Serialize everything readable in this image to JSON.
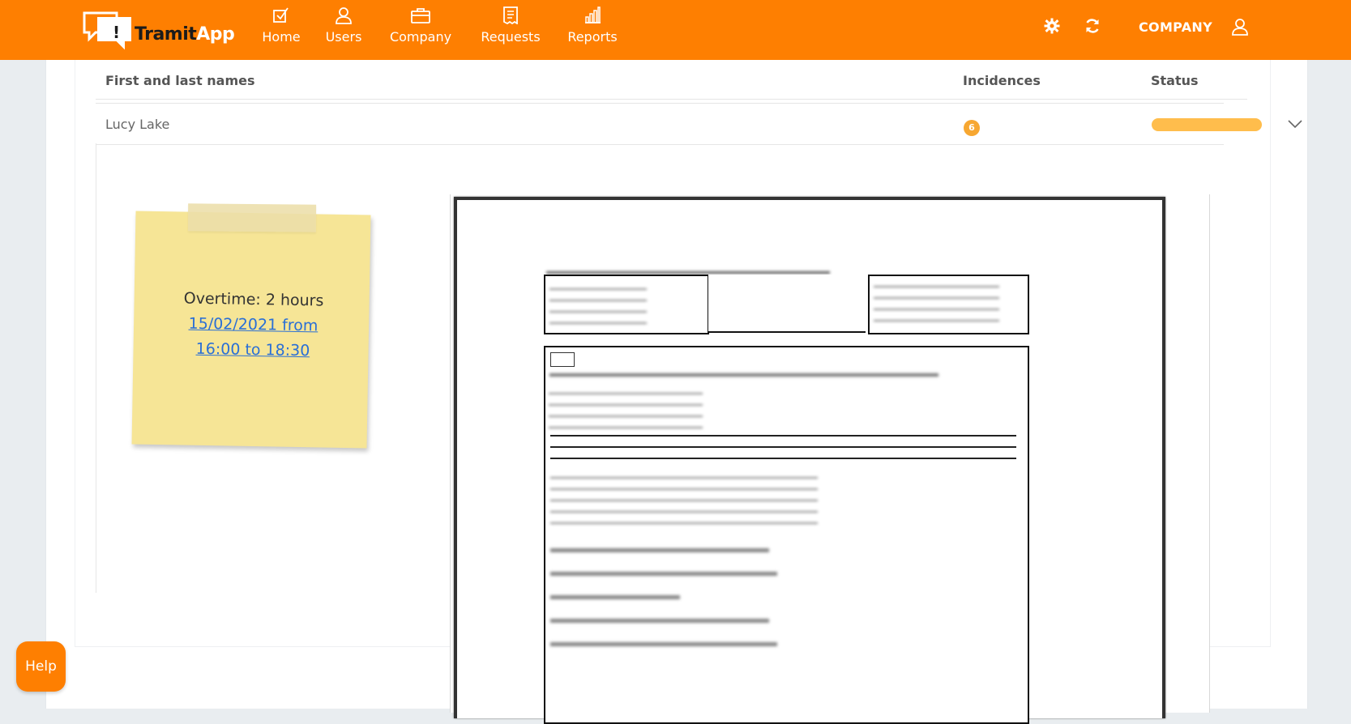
{
  "brand": {
    "name_part1": "Tramit",
    "name_part2": "App",
    "colors": {
      "primary": "#fe7f01",
      "dark": "#1b1b1b"
    }
  },
  "nav": {
    "items": [
      {
        "label": "Home",
        "icon": "checkbox-icon"
      },
      {
        "label": "Users",
        "icon": "user-icon"
      },
      {
        "label": "Company",
        "icon": "briefcase-icon"
      },
      {
        "label": "Requests",
        "icon": "receipt-icon"
      },
      {
        "label": "Reports",
        "icon": "bar-chart-icon"
      }
    ],
    "right": {
      "settings_icon": "gear-icon",
      "refresh_icon": "refresh-icon",
      "company_label": "COMPANY",
      "account_icon": "user-icon"
    }
  },
  "table": {
    "headers": {
      "name": "First and last names",
      "incidences": "Incidences",
      "status": "Status"
    },
    "rows": [
      {
        "name": "Lucy Lake",
        "incidences": "6",
        "status_color": "#ffbd4c"
      }
    ]
  },
  "note": {
    "line1": "Overtime: 2 hours",
    "link_line1": "15/02/2021 from",
    "link_line2": "16:00 to 18:30",
    "color": "#f6e596"
  },
  "help": {
    "label": "Help"
  }
}
